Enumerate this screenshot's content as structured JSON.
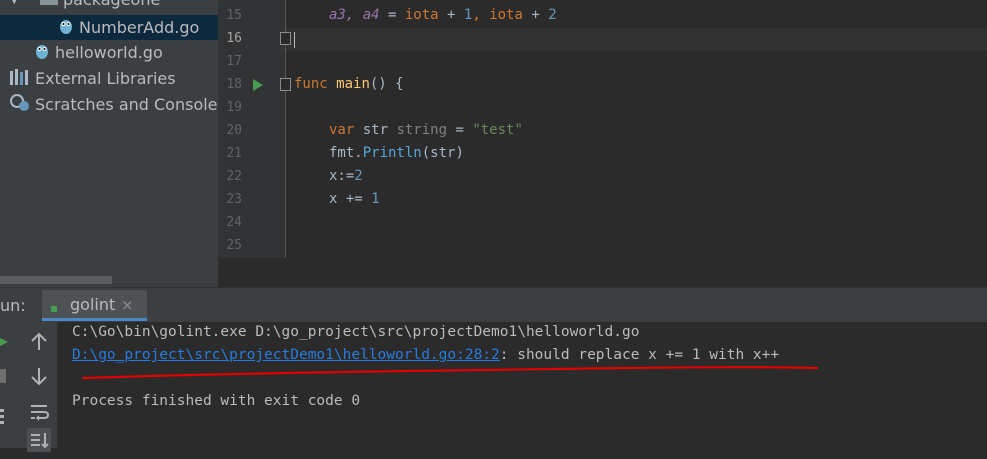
{
  "project_tree": {
    "items": [
      {
        "label": "packageone",
        "icon": "folder-icon"
      },
      {
        "label": "NumberAdd.go",
        "icon": "gopher-icon"
      },
      {
        "label": "helloworld.go",
        "icon": "gopher-icon"
      },
      {
        "label": "External Libraries",
        "icon": "libraries-icon"
      },
      {
        "label": "Scratches and Consoles",
        "icon": "scratches-icon"
      }
    ]
  },
  "editor": {
    "lines": [
      {
        "n": "15"
      },
      {
        "n": "16"
      },
      {
        "n": "17"
      },
      {
        "n": "18"
      },
      {
        "n": "19"
      },
      {
        "n": "20"
      },
      {
        "n": "21"
      },
      {
        "n": "22"
      },
      {
        "n": "23"
      },
      {
        "n": "24"
      },
      {
        "n": "25"
      }
    ],
    "code": {
      "l15_a": "a3, a4",
      "l15_eq": " = ",
      "l15_iota1": "iota",
      "l15_plus1": " + ",
      "l15_one": "1",
      "l15_comma": ", ",
      "l15_iota2": "iota",
      "l15_plus2": " + ",
      "l15_two": "2",
      "l18_func": "func ",
      "l18_main": "main",
      "l18_rest": "() {",
      "l20_var": "var ",
      "l20_str": "str ",
      "l20_type": "string",
      "l20_eq": " = ",
      "l20_val": "\"test\"",
      "l21_fmt": "fmt.",
      "l21_fn": "Println",
      "l21_rest": "(str)",
      "l22_code": "x:=",
      "l22_num": "2",
      "l23_code": "x += ",
      "l23_num": "1"
    }
  },
  "run_panel": {
    "title": "un:",
    "tab_label": "golint",
    "tab_close": "×",
    "console": {
      "line1": "C:\\Go\\bin\\golint.exe D:\\go_project\\src\\projectDemo1\\helloworld.go",
      "line2_link": "D:\\go_project\\src\\projectDemo1\\helloworld.go:28:2",
      "line2_msg": ": should replace x += 1 with x++",
      "line3": "Process finished with exit code 0"
    }
  },
  "colors": {
    "annotation": "#e00000",
    "link": "#287bde",
    "run_green": "#499c54"
  }
}
